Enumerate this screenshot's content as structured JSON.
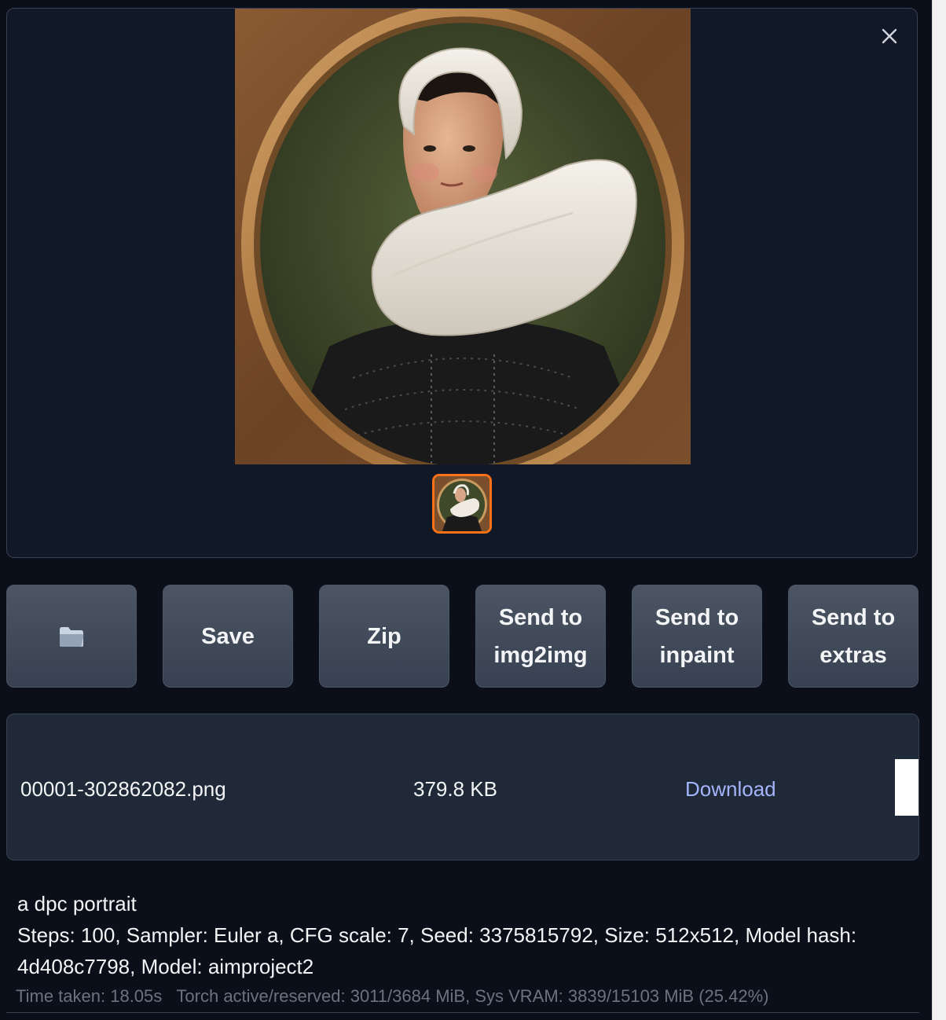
{
  "gallery": {
    "close_label": "close",
    "selected_index": 0,
    "thumbnail_count": 1
  },
  "actions": {
    "open_folder_label": "📂",
    "save_label": "Save",
    "zip_label": "Zip",
    "send_img2img_label": [
      "Send to",
      "img2img"
    ],
    "send_inpaint_label": [
      "Send to",
      "inpaint"
    ],
    "send_extras_label": [
      "Send to",
      "extras"
    ]
  },
  "file": {
    "name": "00001-302862082.png",
    "size": "379.8 KB",
    "download_label": "Download"
  },
  "generation": {
    "prompt": "a dpc portrait",
    "params": "Steps: 100, Sampler: Euler a, CFG scale: 7, Seed: 3375815792, Size: 512x512, Model hash: 4d408c7798, Model: aimproject2",
    "time_taken": "Time taken: 18.05s",
    "memory": "Torch active/reserved: 3011/3684 MiB, Sys VRAM: 3839/15103 MiB (25.42%)"
  },
  "colors": {
    "background": "#0b0f19",
    "panel": "#1f2937",
    "button": "#4b5563",
    "accent_selected": "#f97316",
    "link": "#a5b4fc"
  }
}
